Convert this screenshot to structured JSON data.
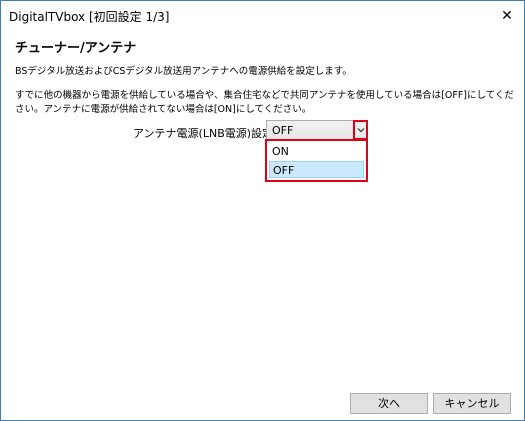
{
  "window": {
    "title": "DigitalTVbox [初回設定 1/3]",
    "close_glyph": "✕"
  },
  "main": {
    "title": "チューナー/アンテナ",
    "description_1": "BSデジタル放送およびCSデジタル放送用アンテナへの電源供給を設定します。",
    "description_2": "すでに他の機器から電源を供給している場合や、集合住宅などで共同アンテナを使用している場合は[OFF]にしてください。アンテナに電源が供給されてない場合は[ON]にしてください。",
    "field_label": "アンテナ電源(LNB電源)設定:",
    "select_value": "OFF",
    "options": [
      "ON",
      "OFF"
    ]
  },
  "buttons": {
    "next": "次へ",
    "cancel": "キャンセル"
  },
  "colors": {
    "highlight_red": "#e0001b",
    "selected_option": "#cce8ff"
  },
  "icons": {
    "close": "close-icon",
    "dropdown": "chevron-down-icon"
  }
}
